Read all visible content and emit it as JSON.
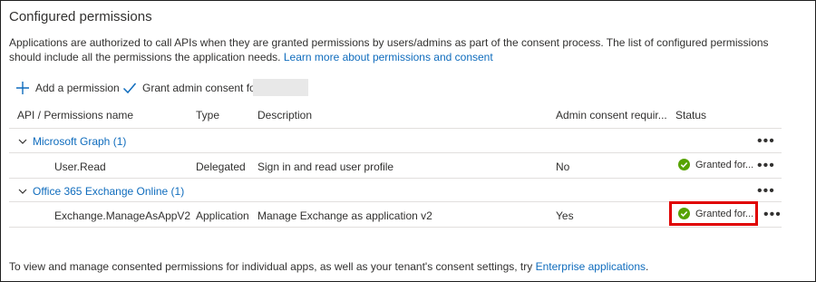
{
  "section": {
    "title": "Configured permissions",
    "description_text": "Applications are authorized to call APIs when they are granted permissions by users/admins as part of the consent process. The list of configured permissions should include all the permissions the application needs.",
    "learn_more_link": "Learn more about permissions and consent"
  },
  "toolbar": {
    "add_permission_label": "Add a permission",
    "grant_consent_label": "Grant admin consent for"
  },
  "table": {
    "headers": {
      "api": "API / Permissions name",
      "type": "Type",
      "description": "Description",
      "admin_consent": "Admin consent requir...",
      "status": "Status"
    },
    "groups": [
      {
        "name": "Microsoft Graph (1)",
        "permissions": [
          {
            "name": "User.Read",
            "type": "Delegated",
            "description": "Sign in and read user profile",
            "admin_consent": "No",
            "status": "Granted for..."
          }
        ]
      },
      {
        "name": "Office 365 Exchange Online (1)",
        "permissions": [
          {
            "name": "Exchange.ManageAsAppV2",
            "type": "Application",
            "description": "Manage Exchange as application v2",
            "admin_consent": "Yes",
            "status": "Granted for..."
          }
        ]
      }
    ],
    "more_glyph": "•••"
  },
  "footer": {
    "text": "To view and manage consented permissions for individual apps, as well as your tenant's consent settings, try",
    "link": "Enterprise applications",
    "period": "."
  },
  "colors": {
    "link": "#0f6cbd",
    "success": "#57a300",
    "highlight": "#e00000",
    "divider": "#e1dfdd"
  },
  "icons": {
    "add": "plus-icon",
    "grant": "checkmark-icon",
    "expand": "chevron-down-icon",
    "status": "success-check-icon",
    "more": "more-options-icon"
  }
}
